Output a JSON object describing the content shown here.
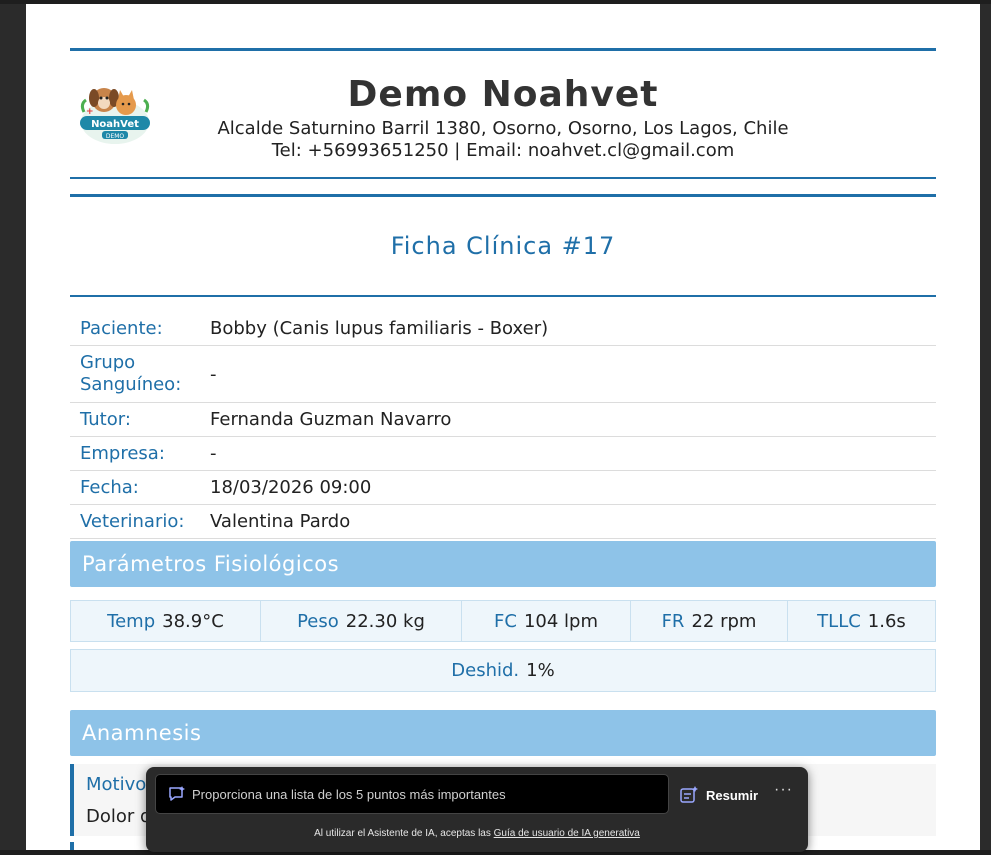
{
  "clinic": {
    "name": "Demo Noahvet",
    "address": "Alcalde Saturnino Barril 1380, Osorno, Osorno, Los Lagos, Chile",
    "contact": "Tel: +56993651250 | Email: noahvet.cl@gmail.com",
    "logo_text": "NoahVet",
    "logo_sub": "DEMO"
  },
  "record": {
    "title": "Ficha Clínica #17",
    "rows": [
      {
        "label": "Paciente:",
        "value": "Bobby (Canis lupus familiaris - Boxer)"
      },
      {
        "label": "Grupo Sanguíneo:",
        "value": "-"
      },
      {
        "label": "Tutor:",
        "value": "Fernanda Guzman Navarro"
      },
      {
        "label": "Empresa:",
        "value": "-"
      },
      {
        "label": "Fecha:",
        "value": "18/03/2026 09:00"
      },
      {
        "label": "Veterinario:",
        "value": "Valentina Pardo"
      }
    ]
  },
  "physiological": {
    "section_title": "Parámetros Fisiológicos",
    "params": [
      {
        "key": "Temp",
        "value": "38.9°C"
      },
      {
        "key": "Peso",
        "value": "22.30 kg"
      },
      {
        "key": "FC",
        "value": "104 lpm"
      },
      {
        "key": "FR",
        "value": "22 rpm"
      },
      {
        "key": "TLLC",
        "value": "1.6s"
      }
    ],
    "dehydration": {
      "key": "Deshid.",
      "value": "1%"
    }
  },
  "anamnesis": {
    "section_title": "Anamnesis",
    "label": "Motivo",
    "text": "Dolor d"
  },
  "ai_assistant": {
    "prompt_placeholder": "Proporciona una lista de los 5 puntos más importantes",
    "summarize_label": "Resumir",
    "more_label": "···",
    "note_prefix": "Al utilizar el Asistente de IA, aceptas las ",
    "note_link": "Guía de usuario de IA generativa"
  },
  "colors": {
    "accent": "#1f6fa8",
    "section_bg": "#8ec3e8",
    "param_bg": "#eef6fb"
  }
}
